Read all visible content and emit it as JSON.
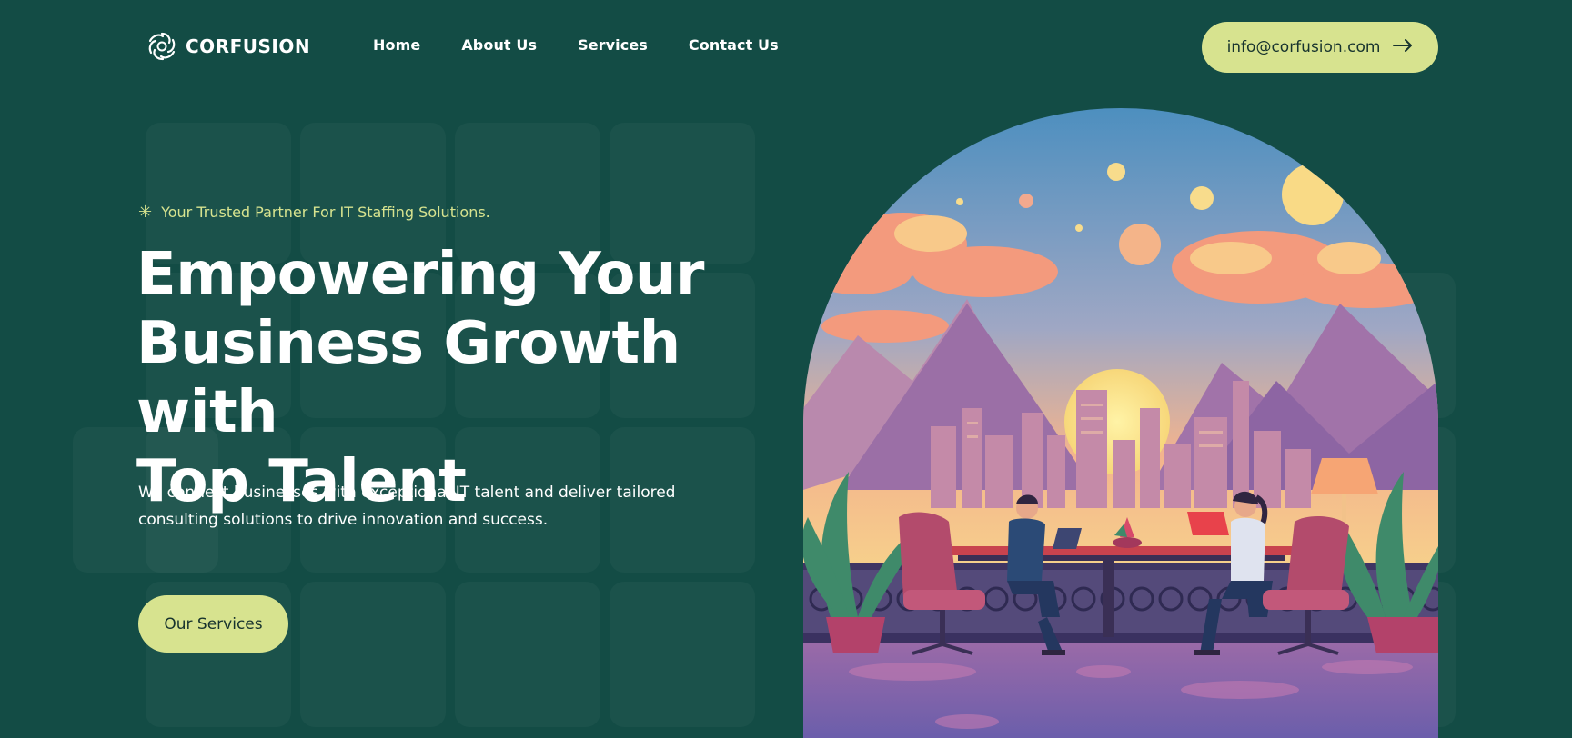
{
  "brand": {
    "name": "CORFUSION"
  },
  "nav": {
    "home": "Home",
    "about": "About Us",
    "services": "Services",
    "contact": "Contact Us"
  },
  "contact": {
    "email": "info@corfusion.com"
  },
  "hero": {
    "tagline": "Your Trusted Partner For IT Staffing Solutions.",
    "headline_line1": "Empowering Your",
    "headline_line2": "Business Growth with",
    "headline_line3": "Top Talent",
    "description": "We connect businesses with exceptional IT talent and deliver tailored consulting solutions to drive innovation and success.",
    "cta": "Our Services"
  },
  "icons": {
    "logo": "swirl-logo-icon",
    "arrow": "arrow-right-icon",
    "tagline": "sparkle-icon"
  },
  "colors": {
    "background": "#134c45",
    "accent": "#d7e38f",
    "text": "#ffffff",
    "button_text": "#17332e"
  }
}
